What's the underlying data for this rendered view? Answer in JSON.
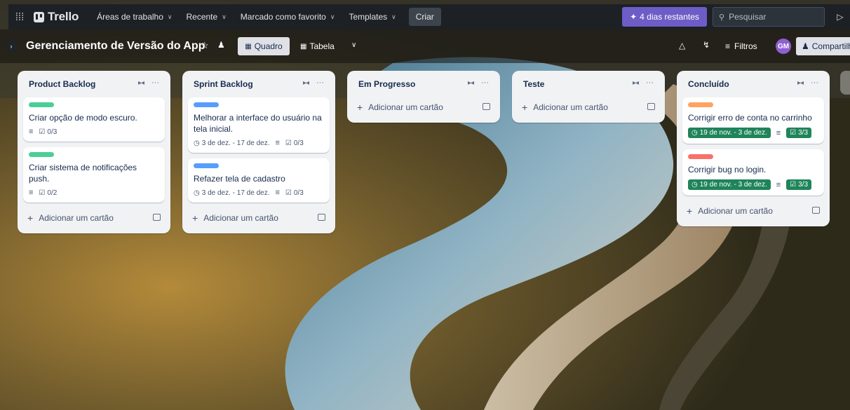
{
  "topnav": {
    "apps_icon": "grid-icon",
    "logo": "Trello",
    "menu": [
      {
        "label": "Áreas de trabalho"
      },
      {
        "label": "Recente"
      },
      {
        "label": "Marcado como favorito"
      },
      {
        "label": "Templates"
      }
    ],
    "create": "Criar",
    "trial": "4 dias restantes",
    "search_placeholder": "Pesquisar",
    "notification_icon": "bell-icon"
  },
  "board": {
    "title": "Gerenciamento de Versão do App",
    "views": {
      "board": "Quadro",
      "table": "Tabela"
    },
    "filters": "Filtros",
    "avatar_initials": "GM",
    "share": "Compartilhar"
  },
  "lists": [
    {
      "title": "Product Backlog",
      "cards": [
        {
          "label_color": "#4bce97",
          "title": "Criar opção de modo escuro.",
          "checklist": "0/3"
        },
        {
          "label_color": "#4bce97",
          "title": "Criar sistema de notificações push.",
          "checklist": "0/2"
        }
      ],
      "add_card": "Adicionar um cartão"
    },
    {
      "title": "Sprint Backlog",
      "cards": [
        {
          "label_color": "#579dff",
          "title": "Melhorar a interface do usuário na tela inicial.",
          "dates": "3 de dez. - 17 de dez.",
          "checklist": "0/3"
        },
        {
          "label_color": "#579dff",
          "title": "Refazer tela de cadastro",
          "dates": "3 de dez. - 17 de dez.",
          "checklist": "0/3"
        }
      ],
      "add_card": "Adicionar um cartão"
    },
    {
      "title": "Em Progresso",
      "cards": [],
      "add_card": "Adicionar um cartão"
    },
    {
      "title": "Teste",
      "cards": [],
      "add_card": "Adicionar um cartão"
    },
    {
      "title": "Concluído",
      "cards": [
        {
          "label_color": "#fea362",
          "title": "Corrigir erro de conta no carrinho",
          "dates": "19 de nov. - 3 de dez.",
          "checklist": "3/3"
        },
        {
          "label_color": "#f87168",
          "title": "Corrigir bug no login.",
          "dates": "19 de nov. - 3 de dez.",
          "checklist": "3/3"
        }
      ],
      "add_card": "Adicionar um cartão"
    }
  ]
}
